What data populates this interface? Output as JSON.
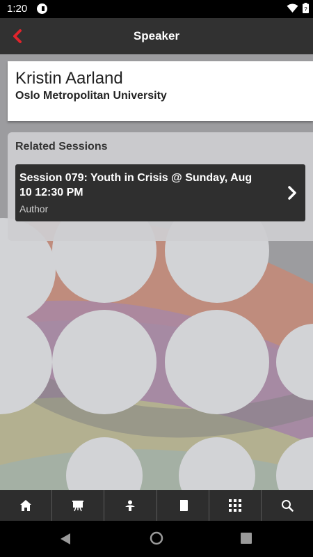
{
  "status_bar": {
    "time": "1:20"
  },
  "header": {
    "title": "Speaker"
  },
  "speaker": {
    "name": "Kristin Aarland",
    "affiliation": "Oslo Metropolitan University"
  },
  "related": {
    "title": "Related Sessions",
    "sessions": [
      {
        "title": "Session 079: Youth in Crisis @ Sunday, Aug 10 12:30 PM",
        "role": "Author"
      }
    ]
  },
  "bottom_nav": {
    "items": [
      "home-icon",
      "presentation-icon",
      "speaker-icon",
      "book-icon",
      "grid-icon",
      "search-icon"
    ]
  },
  "colors": {
    "accent": "#e0242c",
    "header": "#313131",
    "card_dark": "#2f2f2f"
  }
}
